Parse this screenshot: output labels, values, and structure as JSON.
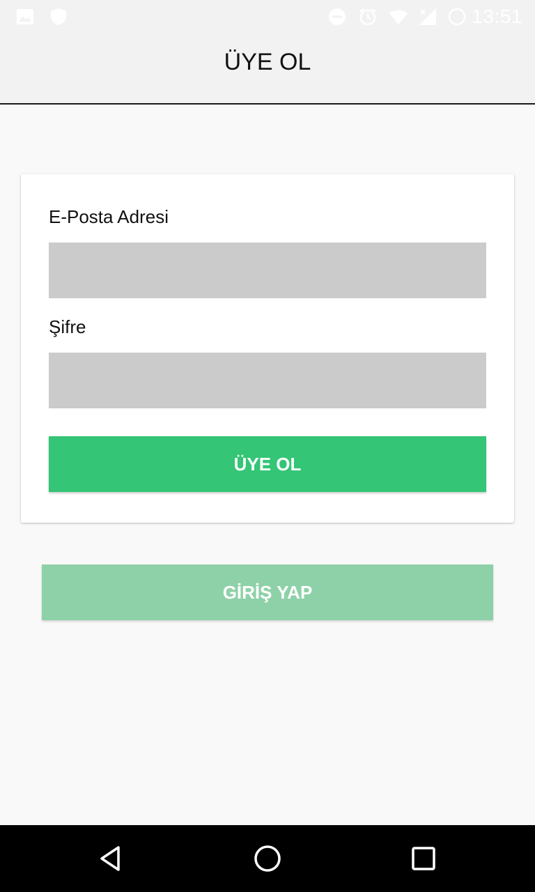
{
  "status_bar": {
    "time": "13:51",
    "left_icons": [
      "image-icon",
      "shield-icon"
    ],
    "right_icons": [
      "do-not-disturb-icon",
      "alarm-icon",
      "wifi-icon",
      "signal-icon",
      "battery-icon"
    ]
  },
  "app_bar": {
    "title": "ÜYE OL"
  },
  "form": {
    "email_label": "E-Posta Adresi",
    "email_value": "",
    "password_label": "Şifre",
    "password_value": "",
    "submit_label": "ÜYE OL"
  },
  "login_button_label": "GİRİŞ YAP",
  "nav_bar": {
    "icons": [
      "back-icon",
      "home-icon",
      "recents-icon"
    ]
  },
  "colors": {
    "primary_green": "#34c576",
    "light_green": "#8ed1a8",
    "input_bg": "#cbcbcb",
    "app_bar_bg": "#f2f2f2",
    "page_bg": "#f9f9f9"
  }
}
